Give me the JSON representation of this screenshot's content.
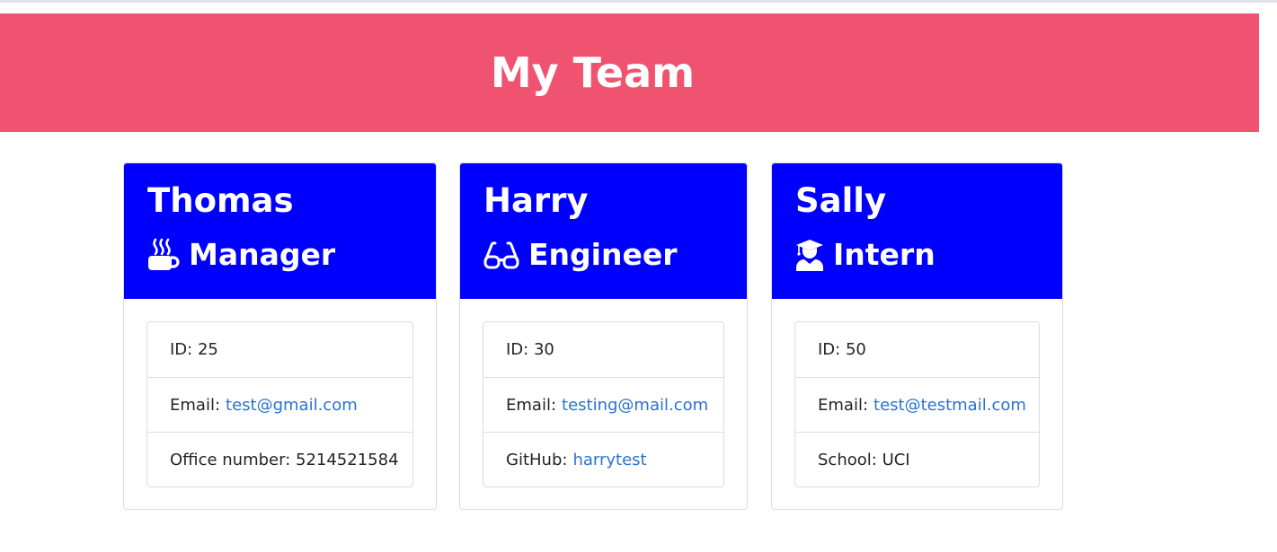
{
  "header": {
    "title": "My Team",
    "background_color": "#f0536f"
  },
  "card_header_color": "#0000ff",
  "team": [
    {
      "name": "Thomas",
      "role": "Manager",
      "role_icon": "mug-hot-icon",
      "id_label": "ID:",
      "id": "25",
      "email_label": "Email:",
      "email": "test@gmail.com",
      "extra_label": "Office number:",
      "extra_value": "5214521584"
    },
    {
      "name": "Harry",
      "role": "Engineer",
      "role_icon": "glasses-icon",
      "id_label": "ID:",
      "id": "30",
      "email_label": "Email:",
      "email": "testing@mail.com",
      "extra_label": "GitHub:",
      "extra_value": "harrytest"
    },
    {
      "name": "Sally",
      "role": "Intern",
      "role_icon": "user-graduate-icon",
      "id_label": "ID:",
      "id": "50",
      "email_label": "Email:",
      "email": "test@testmail.com",
      "extra_label": "School:",
      "extra_value": "UCI"
    }
  ]
}
